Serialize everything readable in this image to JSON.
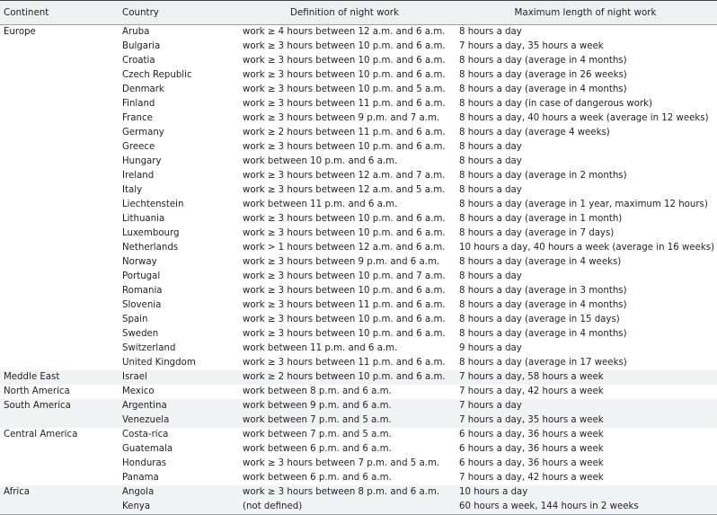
{
  "table": {
    "columns": [
      {
        "key": "continent",
        "label": "Continent"
      },
      {
        "key": "country",
        "label": "Country"
      },
      {
        "key": "definition",
        "label": "Definition of night work"
      },
      {
        "key": "maximum",
        "label": "Maximum length of night work"
      }
    ],
    "colors": {
      "header_background": "#eef1f2",
      "shaded_row_background": "#f1f4f5",
      "plain_row_background": "#ffffff",
      "text": "#231f20",
      "rule": "#3f4446"
    },
    "rows": [
      {
        "continent": "Europe",
        "country": "Aruba",
        "definition": "work ≥ 4 hours between 12 a.m. and 6 a.m.",
        "maximum": "8 hours a day",
        "shaded": false
      },
      {
        "continent": "",
        "country": "Bulgaria",
        "definition": "work ≥ 3 hours between 10 p.m. and 6 a.m.",
        "maximum": "7 hours a day, 35 hours a week",
        "shaded": false
      },
      {
        "continent": "",
        "country": "Croatia",
        "definition": "work ≥ 3 hours between 10 p.m. and 6 a.m.",
        "maximum": "8 hours a day (average in 4 months)",
        "shaded": false
      },
      {
        "continent": "",
        "country": "Czech Republic",
        "definition": "work ≥ 3 hours between 10 p.m. and 6 a.m.",
        "maximum": "8 hours a day (average in 26 weeks)",
        "shaded": false
      },
      {
        "continent": "",
        "country": "Denmark",
        "definition": "work ≥ 3 hours between 10 p.m. and 5 a.m.",
        "maximum": "8 hours a day (average in 4 months)",
        "shaded": false
      },
      {
        "continent": "",
        "country": "Finland",
        "definition": "work ≥ 3 hours between 11 p.m. and 6 a.m.",
        "maximum": "8 hours a day (in case of dangerous work)",
        "shaded": false
      },
      {
        "continent": "",
        "country": "France",
        "definition": "work ≥ 3 hours between 9 p.m. and 7 a.m.",
        "maximum": "8 hours a day, 40 hours a week (average in 12 weeks)",
        "shaded": false
      },
      {
        "continent": "",
        "country": "Germany",
        "definition": "work ≥ 2 hours between 11 p.m. and 6 a.m.",
        "maximum": "8 hours a day (average 4 weeks)",
        "shaded": false
      },
      {
        "continent": "",
        "country": "Greece",
        "definition": "work ≥ 3 hours between 10 p.m. and 6 a.m.",
        "maximum": "8 hours a day",
        "shaded": false
      },
      {
        "continent": "",
        "country": "Hungary",
        "definition": "work between 10 p.m. and 6 a.m.",
        "maximum": "8 hours a day",
        "shaded": false
      },
      {
        "continent": "",
        "country": "Ireland",
        "definition": "work ≥ 3 hours between 12 a.m. and 7 a.m.",
        "maximum": "8 hours a day (average in 2 months)",
        "shaded": false
      },
      {
        "continent": "",
        "country": "Italy",
        "definition": "work ≥ 3 hours between 12 a.m. and 5 a.m.",
        "maximum": "8 hours a day",
        "shaded": false
      },
      {
        "continent": "",
        "country": "Liechtenstein",
        "definition": "work between 11 p.m. and 6 a.m.",
        "maximum": "8 hours a day (average in 1 year, maximum 12 hours)",
        "shaded": false
      },
      {
        "continent": "",
        "country": "Lithuania",
        "definition": "work ≥ 3 hours between 10 p.m. and 6 a.m.",
        "maximum": "8 hours a day (average in 1 month)",
        "shaded": false
      },
      {
        "continent": "",
        "country": "Luxembourg",
        "definition": "work ≥ 3 hours between 10 p.m. and 6 a.m.",
        "maximum": "8 hours a day (average in 7 days)",
        "shaded": false
      },
      {
        "continent": "",
        "country": "Netherlands",
        "definition": "work > 1 hours between 12 a.m. and 6 a.m.",
        "maximum": "10 hours a day, 40 hours a week (average in 16 weeks)",
        "shaded": false
      },
      {
        "continent": "",
        "country": "Norway",
        "definition": "work ≥ 3 hours between 9 p.m. and 6 a.m.",
        "maximum": "8 hours a day (average in 4 weeks)",
        "shaded": false
      },
      {
        "continent": "",
        "country": "Portugal",
        "definition": "work ≥ 3 hours between 10 p.m. and 7 a.m.",
        "maximum": "8 hours a day",
        "shaded": false
      },
      {
        "continent": "",
        "country": "Romania",
        "definition": "work ≥ 3 hours between 10 p.m. and 6 a.m.",
        "maximum": "8 hours a day (average in 3 months)",
        "shaded": false
      },
      {
        "continent": "",
        "country": "Slovenia",
        "definition": "work ≥ 3 hours between 11 p.m. and 6 a.m.",
        "maximum": "8 hours a day (average in 4 months)",
        "shaded": false
      },
      {
        "continent": "",
        "country": "Spain",
        "definition": "work ≥ 3 hours between 10 p.m. and 6 a.m.",
        "maximum": "8 hours a day (average in 15 days)",
        "shaded": false
      },
      {
        "continent": "",
        "country": "Sweden",
        "definition": "work ≥ 3 hours between 10 p.m. and 6 a.m.",
        "maximum": "8 hours a day (average in 4 months)",
        "shaded": false
      },
      {
        "continent": "",
        "country": "Switzerland",
        "definition": "work between 11 p.m. and 6 a.m.",
        "maximum": "9 hours a day",
        "shaded": false
      },
      {
        "continent": "",
        "country": "United Kingdom",
        "definition": "work ≥ 3 hours between 11 p.m. and 6 a.m.",
        "maximum": "8 hours a day (average in 17 weeks)",
        "shaded": false
      },
      {
        "continent": "Meddle East",
        "country": "Israel",
        "definition": "work ≥ 2 hours between 10 p.m. and 6 a.m.",
        "maximum": "7 hours a day, 58 hours a week",
        "shaded": true
      },
      {
        "continent": "North America",
        "country": "Mexico",
        "definition": "work between 8 p.m. and 6 a.m.",
        "maximum": "7 hours a day, 42 hours a week",
        "shaded": false
      },
      {
        "continent": "South America",
        "country": "Argentina",
        "definition": "work between 9 p.m. and 6 a.m.",
        "maximum": "7 hours a day",
        "shaded": true
      },
      {
        "continent": "",
        "country": "Venezuela",
        "definition": "work between 7 p.m. and 5 a.m.",
        "maximum": "7 hours a day, 35 hours a week",
        "shaded": true
      },
      {
        "continent": "Central America",
        "country": "Costa-rica",
        "definition": "work between 7 p.m. and 5 a.m.",
        "maximum": "6 hours a day, 36 hours a week",
        "shaded": false
      },
      {
        "continent": "",
        "country": "Guatemala",
        "definition": "work between 6 p.m. and 6 a.m.",
        "maximum": "6 hours a day, 36 hours a week",
        "shaded": false
      },
      {
        "continent": "",
        "country": "Honduras",
        "definition": "work ≥ 3 hours between 7 p.m. and 5 a.m.",
        "maximum": "6 hours a day, 36 hours a week",
        "shaded": false
      },
      {
        "continent": "",
        "country": "Panama",
        "definition": "work between 6 p.m. and 6 a.m.",
        "maximum": "7 hours a day, 42 hours a week",
        "shaded": false
      },
      {
        "continent": "Africa",
        "country": "Angola",
        "definition": "work ≥ 3 hours between 8 p.m. and 6 a.m.",
        "maximum": "10 hours a day",
        "shaded": true
      },
      {
        "continent": "",
        "country": "Kenya",
        "definition": "(not defined)",
        "maximum": "60 hours a week, 144 hours in 2 weeks",
        "shaded": true
      }
    ]
  }
}
